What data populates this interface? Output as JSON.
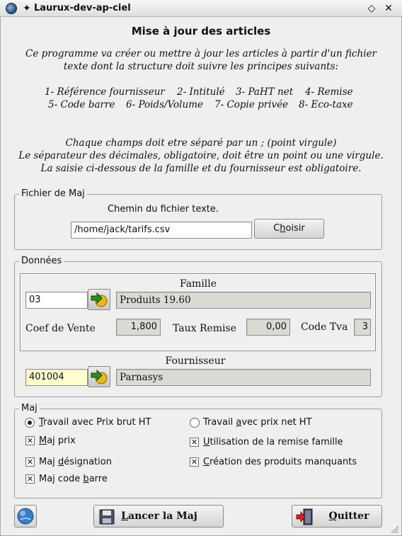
{
  "window": {
    "title": "Laurux-dev-ap-ciel",
    "pin_glyph": "✦",
    "menu_glyph": "◇",
    "close_glyph": "✕"
  },
  "header": {
    "title": "Mise à jour des articles",
    "intro_line1": "Ce programme va créer ou mettre à jour les articles à partir d'un fichier",
    "intro_line2": "texte dont la structure doit suivre les principes suivants:",
    "fields_row1": [
      "1- Référence  fournisseur",
      "2- Intitulé",
      "3- PaHT net",
      "4- Remise"
    ],
    "fields_row2": [
      "5- Code barre",
      "6- Poids/Volume",
      "7- Copie privée",
      "8- Eco-taxe"
    ],
    "rule1": "Chaque champs doit etre séparé par un ; (point virgule)",
    "rule2": "Le séparateur des décimales, obligatoire, doit être un point ou une virgule.",
    "rule3": "La saisie ci-dessous de la famille et du fournisseur est obligatoire."
  },
  "fichier": {
    "legend": "Fichier de Maj",
    "label": "Chemin du fichier texte.",
    "path_value": "/home/jack/tarifs.csv",
    "choose_pre": "C",
    "choose_ul": "h",
    "choose_post": "oisir"
  },
  "donnees": {
    "legend": "Données",
    "famille_title": "Famille",
    "famille_code": "03",
    "famille_name": "Produits 19.60",
    "coef_label": "Coef de Vente",
    "coef_value": "1,800",
    "remise_label": "Taux Remise",
    "remise_value": "0,00",
    "tva_label": "Code Tva",
    "tva_value": "3",
    "fournisseur_title": "Fournisseur",
    "fournisseur_code": "401004",
    "fournisseur_name": "Parnasys"
  },
  "maj": {
    "legend": "Maj",
    "radio_brut": {
      "pre": "",
      "ul": "T",
      "post": "ravail avec Prix brut HT",
      "checked": true
    },
    "radio_net": {
      "pre": "Travail ",
      "ul": "a",
      "post": "vec prix net HT",
      "checked": false
    },
    "cb_prix": {
      "pre": "",
      "ul": "M",
      "post": "aj prix",
      "checked": true
    },
    "cb_remise": {
      "pre": "",
      "ul": "U",
      "post": "tilisation de la remise famille",
      "checked": true
    },
    "cb_designation": {
      "pre": "Maj ",
      "ul": "d",
      "post": "ésignation",
      "checked": true
    },
    "cb_creation": {
      "pre": "",
      "ul": "C",
      "post": "réation des produits manquants",
      "checked": true
    },
    "cb_codebarre": {
      "pre": "Maj code ",
      "ul": "b",
      "post": "arre",
      "checked": true
    },
    "check_glyph": "✕"
  },
  "footer": {
    "launch_pre": "",
    "launch_ul": "L",
    "launch_post": "ancer la Maj",
    "quit_pre": "",
    "quit_ul": "Q",
    "quit_post": "uitter"
  },
  "colors": {
    "yellow_field": "#ffffd0",
    "readonly_field": "#dcdad5",
    "go_arrow": "#2e8b1e",
    "go_circle": "#e8b81c"
  }
}
